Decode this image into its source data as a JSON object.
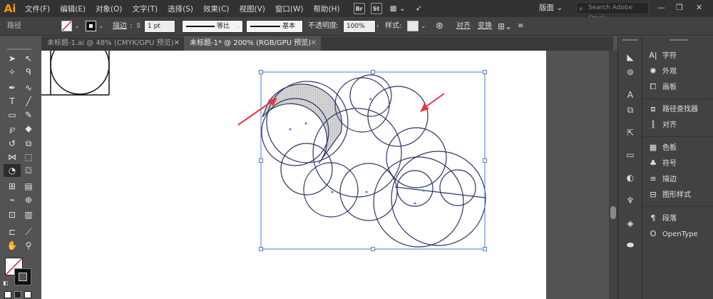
{
  "app": {
    "logo": "Ai"
  },
  "menu": [
    "文件(F)",
    "编辑(E)",
    "对象(O)",
    "文字(T)",
    "选择(S)",
    "效果(C)",
    "视图(V)",
    "窗口(W)",
    "帮助(H)"
  ],
  "app_icons": [
    "Br",
    "St"
  ],
  "workspace": "版面",
  "search": {
    "placeholder": "Search Adobe Stock"
  },
  "control": {
    "selection_label": "路径",
    "stroke_label": "描边",
    "stroke_weight": "1 pt",
    "profile_label": "等比",
    "brush_label": "基本",
    "opacity_label": "不透明度",
    "opacity_value": "100%",
    "style_label": "样式",
    "align_label": "对齐",
    "transform_label": "变换"
  },
  "tabs": [
    {
      "label": "未标题-1.ai @ 48% (CMYK/GPU 预览)",
      "active": false
    },
    {
      "label": "未标题-1* @ 200% (RGB/GPU 预览)",
      "active": true
    }
  ],
  "panels": [
    {
      "label": "字符",
      "icon": "character-icon"
    },
    {
      "label": "外观",
      "icon": "appearance-icon"
    },
    {
      "label": "画板",
      "icon": "artboard-icon"
    },
    {
      "label": "路径查找器",
      "icon": "pathfinder-icon"
    },
    {
      "label": "对齐",
      "icon": "align-icon"
    },
    {
      "label": "色板",
      "icon": "swatches-icon"
    },
    {
      "label": "符号",
      "icon": "symbols-icon"
    },
    {
      "label": "描边",
      "icon": "stroke-icon"
    },
    {
      "label": "图形样式",
      "icon": "graphic-styles-icon"
    },
    {
      "label": "段落",
      "icon": "paragraph-icon"
    },
    {
      "label": "OpenType",
      "icon": "opentype-icon"
    }
  ],
  "colors": {
    "accent_arrow": "#e8383d",
    "path_stroke": "#2b3467",
    "selection": "#4a7bd6",
    "fill_shape": "#c8c8c8"
  }
}
